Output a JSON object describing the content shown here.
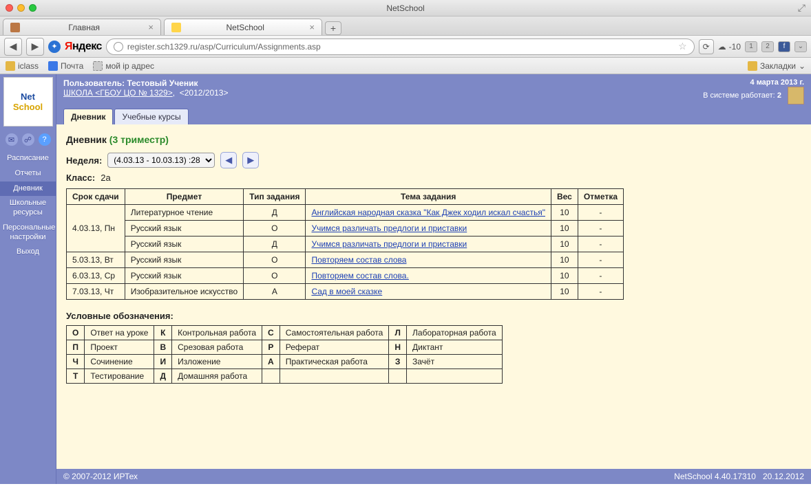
{
  "os": {
    "title": "NetSchool"
  },
  "browser": {
    "tabs": [
      {
        "title": "Главная",
        "active": false
      },
      {
        "title": "NetSchool",
        "active": true
      }
    ],
    "url": "register.sch1329.ru/asp/Curriculum/Assignments.asp",
    "yandex": "Яндекс",
    "weather_temp": "-10",
    "badge1": "1",
    "badge2": "2",
    "bookmarks": [
      "iclass",
      "Почта",
      "мой ip адрес"
    ],
    "bookmarks_label": "Закладки"
  },
  "sidebar": {
    "items": [
      "Расписание",
      "Отчеты",
      "Дневник",
      "Школьные ресурсы",
      "Персональные настройки",
      "Выход"
    ],
    "active_index": 2,
    "help": "?"
  },
  "header": {
    "user_label": "Пользователь:",
    "user_name": "Тестовый Ученик",
    "school": "ШКОЛА <ГБОУ ЦО № 1329>",
    "year": "<2012/2013>",
    "date": "4 марта 2013 г.",
    "online_label": "В системе работает:",
    "online_count": "2"
  },
  "page_tabs": {
    "items": [
      "Дневник",
      "Учебные курсы"
    ],
    "active": 0
  },
  "diary": {
    "title": "Дневник",
    "term": "(3 триместр)",
    "week_label": "Неделя:",
    "week_value": "(4.03.13 - 10.03.13) :28",
    "class_label": "Класс:",
    "class_value": "2а",
    "columns": [
      "Срок сдачи",
      "Предмет",
      "Тип задания",
      "Тема задания",
      "Вес",
      "Отметка"
    ],
    "rows": [
      {
        "date": "4.03.13, Пн",
        "subject": "Литературное чтение",
        "type": "Д",
        "topic": "Английская народная сказка \"Как Джек ходил искал счастья\"",
        "weight": "10",
        "mark": "-",
        "rowspan": 3
      },
      {
        "date": "",
        "subject": "Русский язык",
        "type": "О",
        "topic": "Учимся различать предлоги и приставки",
        "weight": "10",
        "mark": "-"
      },
      {
        "date": "",
        "subject": "Русский язык",
        "type": "Д",
        "topic": "Учимся различать предлоги и приставки",
        "weight": "10",
        "mark": "-"
      },
      {
        "date": "5.03.13, Вт",
        "subject": "Русский язык",
        "type": "О",
        "topic": "Повторяем состав слова",
        "weight": "10",
        "mark": "-"
      },
      {
        "date": "6.03.13, Ср",
        "subject": "Русский язык",
        "type": "О",
        "topic": "Повторяем состав слова.",
        "weight": "10",
        "mark": "-"
      },
      {
        "date": "7.03.13, Чт",
        "subject": "Изобразительное искусство",
        "type": "А",
        "topic": "Сад в моей сказке",
        "weight": "10",
        "mark": "-"
      }
    ],
    "legend_title": "Условные обозначения:",
    "legend": [
      [
        {
          "k": "О",
          "v": "Ответ на уроке"
        },
        {
          "k": "К",
          "v": "Контрольная работа"
        },
        {
          "k": "С",
          "v": "Самостоятельная работа"
        },
        {
          "k": "Л",
          "v": "Лабораторная работа"
        }
      ],
      [
        {
          "k": "П",
          "v": "Проект"
        },
        {
          "k": "В",
          "v": "Срезовая работа"
        },
        {
          "k": "Р",
          "v": "Реферат"
        },
        {
          "k": "Н",
          "v": "Диктант"
        }
      ],
      [
        {
          "k": "Ч",
          "v": "Сочинение"
        },
        {
          "k": "И",
          "v": "Изложение"
        },
        {
          "k": "А",
          "v": "Практическая работа"
        },
        {
          "k": "З",
          "v": "Зачёт"
        }
      ],
      [
        {
          "k": "Т",
          "v": "Тестирование"
        },
        {
          "k": "Д",
          "v": "Домашняя работа"
        },
        {
          "k": "",
          "v": ""
        },
        {
          "k": "",
          "v": ""
        }
      ]
    ]
  },
  "footer": {
    "copyright": "© 2007-2012 ИРТех",
    "version": "NetSchool 4.40.17310",
    "build_date": "20.12.2012"
  }
}
